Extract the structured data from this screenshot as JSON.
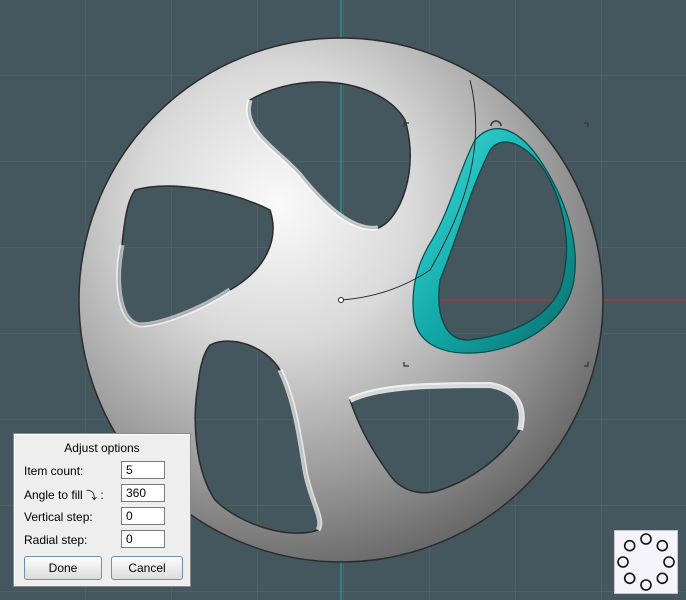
{
  "dialog": {
    "title": "Adjust options",
    "fields": [
      {
        "label": "Item count:",
        "value": "5"
      },
      {
        "label": "Angle to fill",
        "suffix": ":",
        "value": "360"
      },
      {
        "label": "Vertical step:",
        "value": "0"
      },
      {
        "label": "Radial step:",
        "value": "0"
      }
    ],
    "done_label": "Done",
    "cancel_label": "Cancel"
  },
  "icons": {
    "angle": "angle-arrow-icon",
    "pattern": "circular-pattern-icon"
  },
  "colors": {
    "viewport_bg": "#44575f",
    "highlight": "#18b5b5",
    "x_axis": "#cc3333",
    "y_axis": "#2aa6a6"
  }
}
